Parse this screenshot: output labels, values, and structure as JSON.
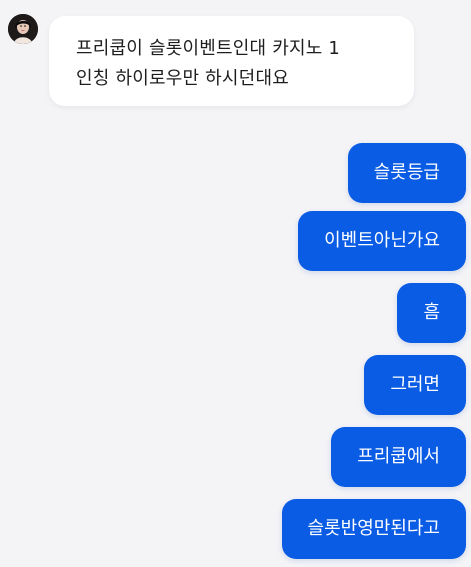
{
  "incoming": {
    "avatar_icon": "profile-photo",
    "lines": [
      "프리쿱이 슬롯이벤트인대 카지노 1",
      "인칭 하이로우만 하시던대요"
    ]
  },
  "outgoing": [
    "슬롯등급",
    "이벤트아닌가요",
    "흠",
    "그러면",
    "프리쿱에서",
    "슬롯반영만된다고"
  ],
  "colors": {
    "outgoing_bubble": "#0a5ce5",
    "incoming_bubble": "#ffffff",
    "background": "#f4f4f7"
  }
}
